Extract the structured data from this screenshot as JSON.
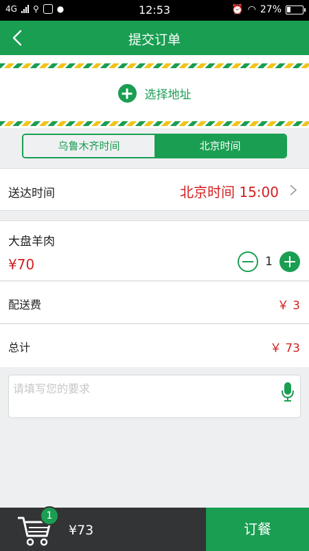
{
  "status_bar": {
    "network": "4G",
    "time": "12:53",
    "battery_percent": "27%",
    "battery_level": 0.27
  },
  "navbar": {
    "title": "提交订单",
    "back_icon": "chevron-left-icon"
  },
  "address": {
    "label": "选择地址",
    "icon": "plus-circle-icon"
  },
  "timezone": {
    "options": [
      "乌鲁木齐时间",
      "北京时间"
    ],
    "selected": "北京时间"
  },
  "delivery": {
    "label": "送达时间",
    "value": "北京时间 15:00",
    "icon": "chevron-right-icon"
  },
  "order_item": {
    "name": "大盘羊肉",
    "price": "¥70",
    "quantity": "1"
  },
  "fees": {
    "delivery_label": "配送费",
    "delivery_amount": "￥ 3",
    "total_label": "总计",
    "total_amount": "￥ 73"
  },
  "note": {
    "placeholder": "请填写您的要求",
    "value": "",
    "icon": "microphone-icon"
  },
  "bottom_bar": {
    "cart_count": "1",
    "total": "¥73",
    "order_label": "订餐",
    "cart_icon": "shopping-cart-icon"
  },
  "colors": {
    "primary_green": "#1a9e52",
    "price_red": "#d31f1f",
    "bar_dark": "#333436",
    "stripe_yellow": "#f0c419"
  }
}
